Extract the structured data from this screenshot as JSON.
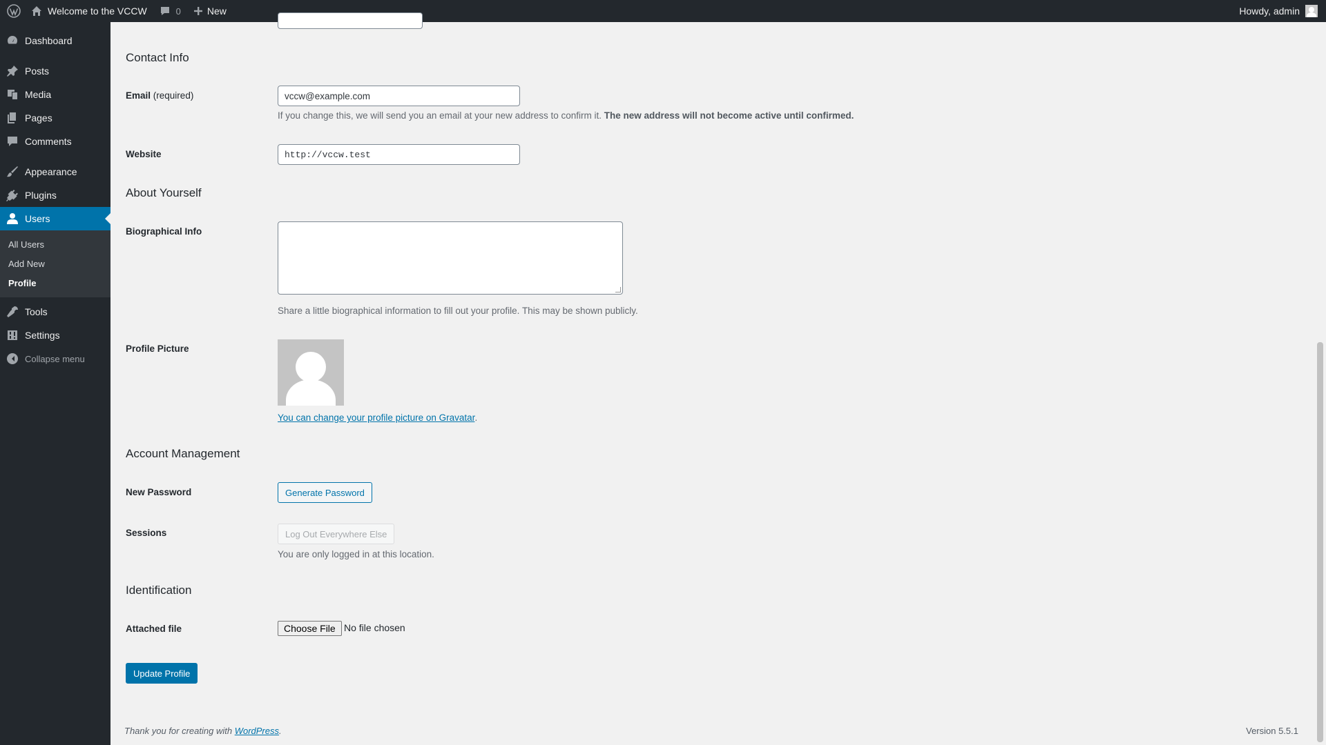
{
  "admin_bar": {
    "site_name": "Welcome to the VCCW",
    "comments_count": "0",
    "new_label": "New",
    "greeting": "Howdy, admin"
  },
  "sidebar": {
    "items": [
      {
        "label": "Dashboard",
        "icon": "dashboard-icon"
      },
      {
        "label": "Posts",
        "icon": "pin-icon"
      },
      {
        "label": "Media",
        "icon": "media-icon"
      },
      {
        "label": "Pages",
        "icon": "pages-icon"
      },
      {
        "label": "Comments",
        "icon": "comment-icon"
      },
      {
        "label": "Appearance",
        "icon": "brush-icon"
      },
      {
        "label": "Plugins",
        "icon": "plug-icon"
      },
      {
        "label": "Users",
        "icon": "user-icon"
      },
      {
        "label": "Tools",
        "icon": "wrench-icon"
      },
      {
        "label": "Settings",
        "icon": "settings-icon"
      }
    ],
    "users_submenu": [
      "All Users",
      "Add New",
      "Profile"
    ],
    "collapse_label": "Collapse menu"
  },
  "profile": {
    "contact_title": "Contact Info",
    "email_label": "Email",
    "email_required": "(required)",
    "email_value": "vccw@example.com",
    "email_desc": "If you change this, we will send you an email at your new address to confirm it.",
    "email_desc_bold": "The new address will not become active until confirmed.",
    "website_label": "Website",
    "website_value": "http://vccw.test",
    "about_title": "About Yourself",
    "bio_label": "Biographical Info",
    "bio_value": "",
    "bio_desc": "Share a little biographical information to fill out your profile. This may be shown publicly.",
    "picture_label": "Profile Picture",
    "gravatar_link": "You can change your profile picture on Gravatar",
    "account_title": "Account Management",
    "new_password_label": "New Password",
    "generate_password_button": "Generate Password",
    "sessions_label": "Sessions",
    "logout_everywhere_button": "Log Out Everywhere Else",
    "sessions_desc": "You are only logged in at this location.",
    "identification_title": "Identification",
    "attached_file_label": "Attached file",
    "choose_file_button": "Choose File",
    "file_status": "No file chosen",
    "update_button": "Update Profile"
  },
  "footer": {
    "thanks_prefix": "Thank you for creating with",
    "wordpress_link": "WordPress",
    "version": "Version 5.5.1"
  }
}
